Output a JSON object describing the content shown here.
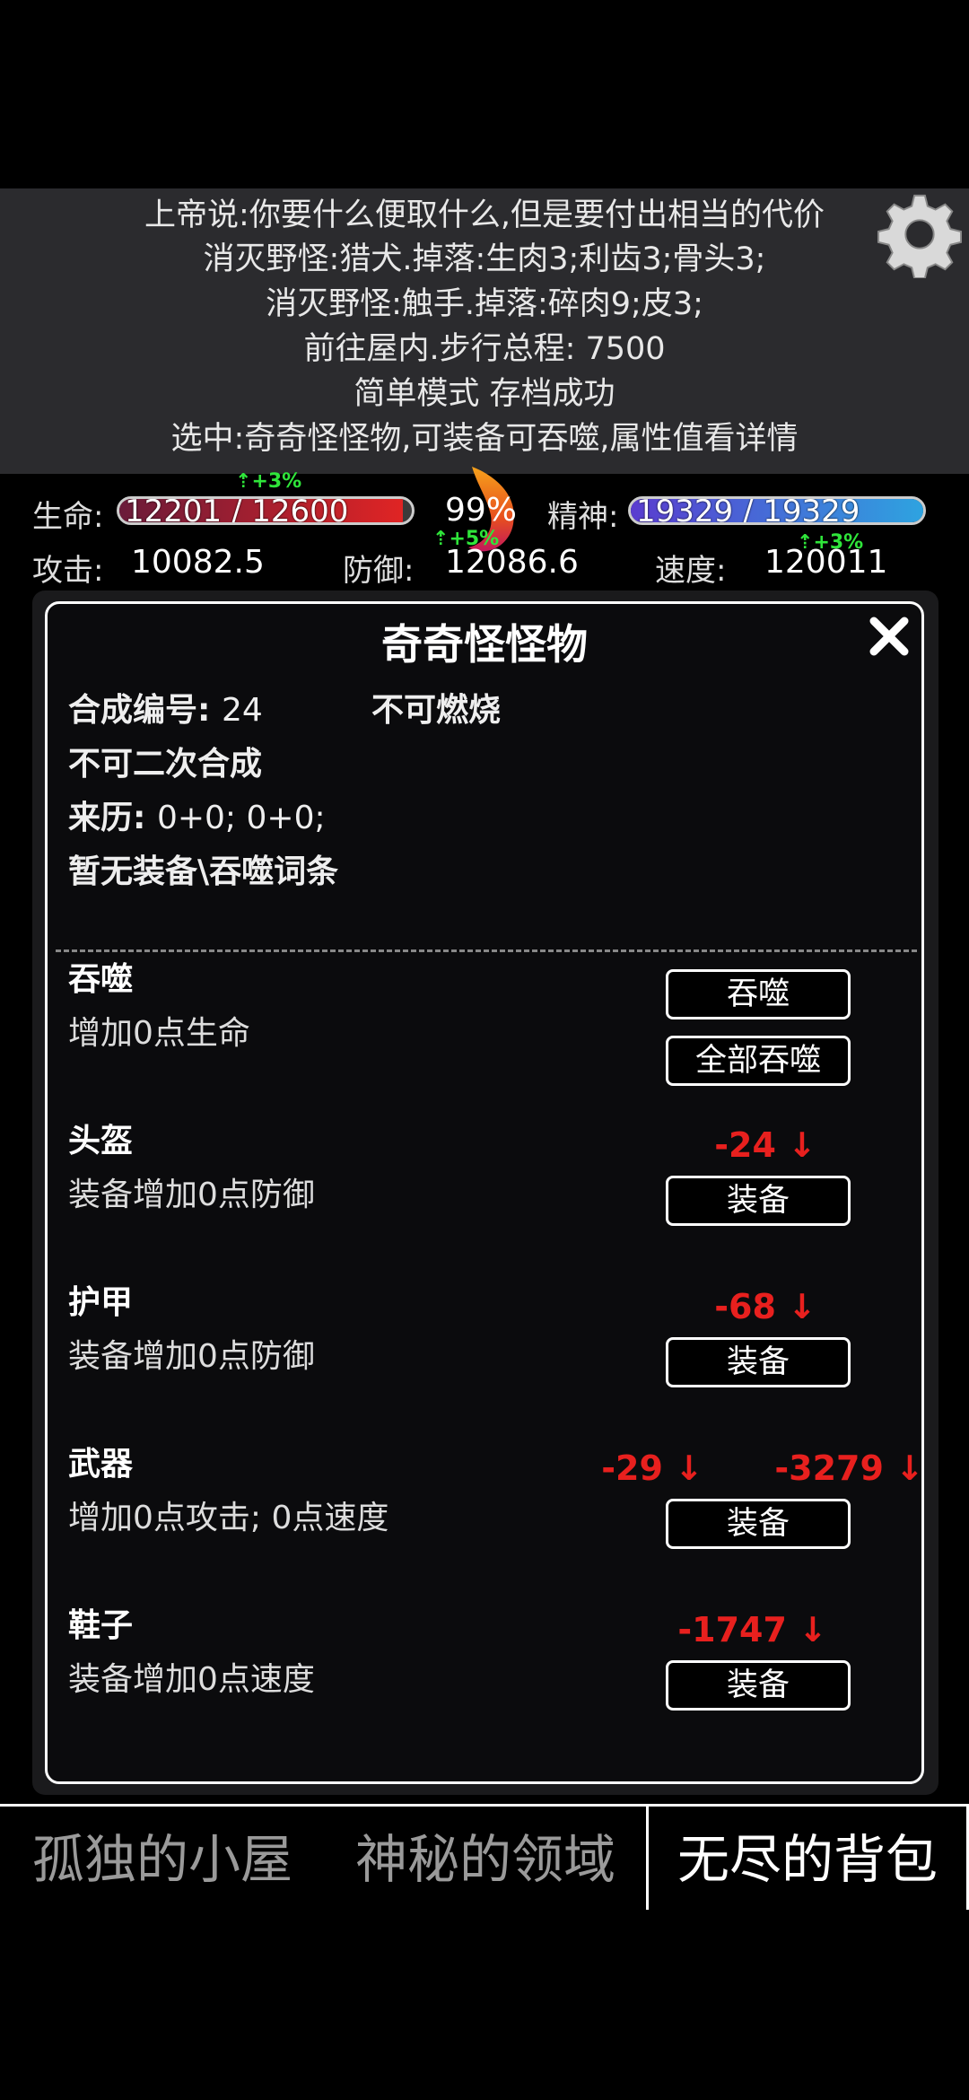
{
  "messages": [
    "上帝说:你要什么便取什么,但是要付出相当的代价",
    "消灭野怪:猎犬.掉落:生肉3;利齿3;骨头3;",
    "消灭野怪:触手.掉落:碎肉9;皮3;",
    "前往屋内.步行总程: 7500",
    "简单模式 存档成功",
    "选中:奇奇怪怪物,可装备可吞噬,属性值看详情"
  ],
  "stats": {
    "hp_label": "生命:",
    "hp_text": "12201 / 12600",
    "hp_fraction": 0.968,
    "hp_buff": "+3%",
    "center_percent": "99%",
    "mind_label": "精神:",
    "mind_text": "19329 / 19329",
    "mind_fraction": 1.0,
    "attack_label": "攻击:",
    "attack_value": "10082.5",
    "defense_label": "防御:",
    "defense_value": "12086.6",
    "defense_buff": "+5%",
    "speed_label": "速度:",
    "speed_value": "120011",
    "speed_buff": "+3%"
  },
  "dialog": {
    "title": "奇奇怪怪物",
    "craft_id_label": "合成编号:",
    "craft_id_value": "24",
    "flammable": "不可燃烧",
    "no_recraft": "不可二次合成",
    "origin_label": "来历:",
    "origin_value": "0+0; 0+0;",
    "affix_text": "暂无装备\\吞噬词条",
    "sections": [
      {
        "title": "吞噬",
        "desc": "增加0点生命",
        "buttons": [
          "吞噬",
          "全部吞噬"
        ]
      },
      {
        "title": "头盔",
        "desc": "装备增加0点防御",
        "deltas": [
          "-24 ↓"
        ],
        "buttons": [
          "装备"
        ]
      },
      {
        "title": "护甲",
        "desc": "装备增加0点防御",
        "deltas": [
          "-68 ↓"
        ],
        "buttons": [
          "装备"
        ]
      },
      {
        "title": "武器",
        "desc": "增加0点攻击; 0点速度",
        "deltas": [
          "-29 ↓",
          "-3279 ↓"
        ],
        "buttons": [
          "装备"
        ]
      },
      {
        "title": "鞋子",
        "desc": "装备增加0点速度",
        "deltas": [
          "-1747 ↓"
        ],
        "buttons": [
          "装备"
        ]
      }
    ]
  },
  "tabs": [
    {
      "label": "孤独的小屋",
      "active": false
    },
    {
      "label": "神秘的领域",
      "active": false
    },
    {
      "label": "无尽的背包",
      "active": true
    }
  ],
  "colors": {
    "hp_bar": "#e02424",
    "mind_bar_from": "#5a3ccf",
    "mind_bar_to": "#2ea3e0",
    "delta": "#e8201e",
    "buff": "#2fe53a"
  },
  "icons": [
    "moon-icon",
    "gear-icon",
    "flame-icon",
    "close-icon"
  ]
}
